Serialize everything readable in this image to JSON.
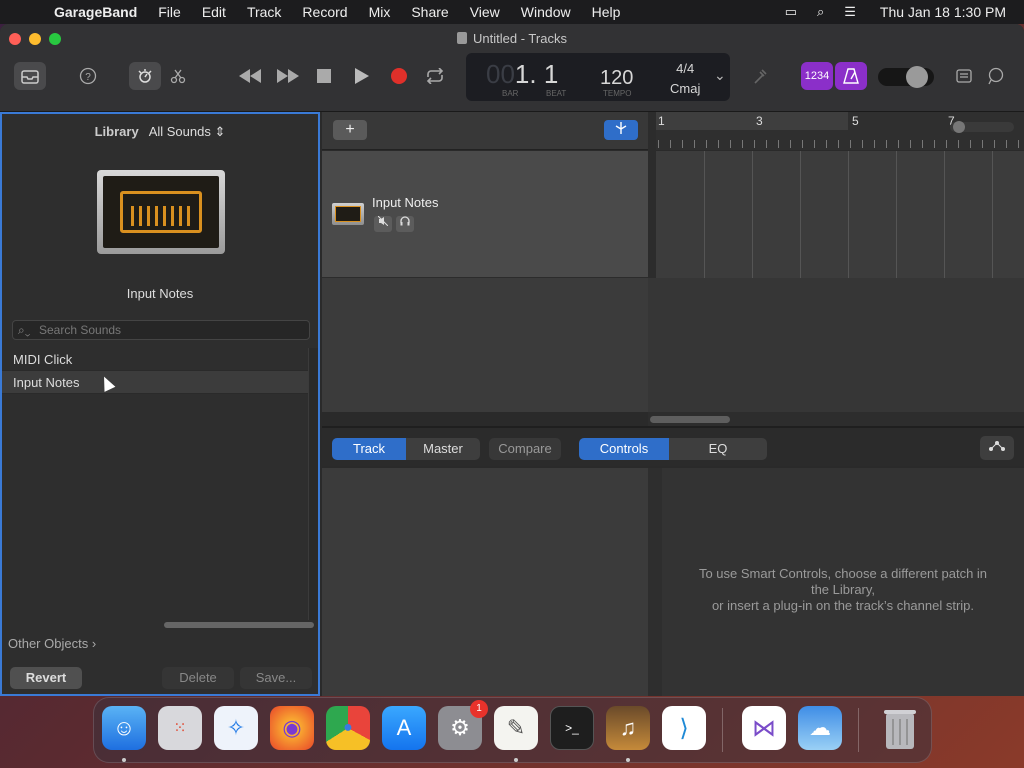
{
  "menubar": {
    "app": "GarageBand",
    "items": [
      "File",
      "Edit",
      "Track",
      "Record",
      "Mix",
      "Share",
      "View",
      "Window",
      "Help"
    ],
    "clock": "Thu Jan 18  1:30 PM"
  },
  "window": {
    "title": "Untitled - Tracks"
  },
  "lcd": {
    "bar_dim": "00",
    "bar": "1. 1",
    "bar_label": "BAR",
    "beat_label": "BEAT",
    "tempo": "120",
    "tempo_label": "TEMPO",
    "time_sig": "4/4",
    "key": "Cmaj"
  },
  "toolbar": {
    "count_in": "1234"
  },
  "library": {
    "label": "Library",
    "filter": "All Sounds",
    "patch_name": "Input Notes",
    "search_placeholder": "Search Sounds",
    "items": [
      {
        "label": "MIDI Click",
        "selected": false
      },
      {
        "label": "Input Notes",
        "selected": true
      }
    ],
    "other_objects": "Other Objects",
    "revert": "Revert",
    "delete": "Delete",
    "save": "Save..."
  },
  "tracks": {
    "add_label": "+",
    "track_name": "Input Notes",
    "ruler": [
      "1",
      "3",
      "5",
      "7"
    ]
  },
  "smart_controls": {
    "tabs_left": [
      "Track",
      "Master",
      "Compare"
    ],
    "tabs_right": [
      "Controls",
      "EQ"
    ],
    "message_line1": "To use Smart Controls, choose a different patch in",
    "message_line2": "the Library,",
    "message_line3": "or insert a plug-in on the track’s channel strip."
  },
  "dock": {
    "apps": [
      "Finder",
      "Launchpad",
      "Safari",
      "Firefox",
      "Chrome",
      "App Store",
      "System Settings",
      "TextEdit",
      "Terminal",
      "GarageBand",
      "Visual Studio Code",
      "Visual Studio",
      "Weather",
      "Trash"
    ],
    "system_settings_badge": "1"
  },
  "colors": {
    "accent": "#2f6ec9",
    "record": "#e0302a",
    "purple": "#8b2fc9"
  }
}
